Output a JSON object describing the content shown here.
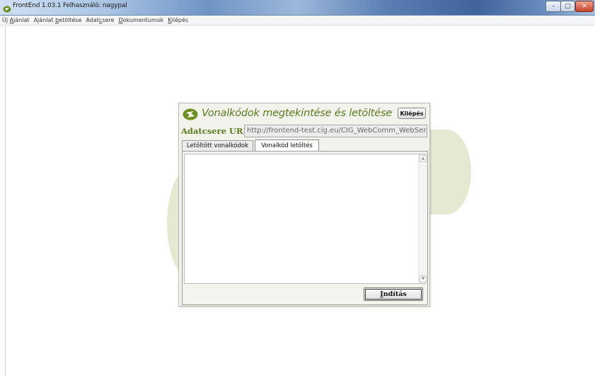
{
  "window": {
    "title": "FrontEnd 1.03.1  Felhasználó: nagypal",
    "controls": {
      "minimize": "–",
      "maximize": "▢",
      "close": "✕"
    }
  },
  "menu": {
    "items": [
      {
        "prefix": "Új ",
        "accel": "A",
        "suffix": "jánlat"
      },
      {
        "prefix": "Ajánlat ",
        "accel": "b",
        "suffix": "etöltése"
      },
      {
        "prefix": "Adat",
        "accel": "c",
        "suffix": "sere"
      },
      {
        "prefix": "",
        "accel": "D",
        "suffix": "okumentumok"
      },
      {
        "prefix": "",
        "accel": "K",
        "suffix": "ilépés"
      }
    ]
  },
  "dialog": {
    "title": "Vonalkódok megtekintése és letöltése",
    "exit_button": "Kilépés",
    "url_label": "Adatcsere URL:",
    "url_value": "http://frontend-test.cig.eu/CIG_WebComm_WebSer...",
    "tabs": [
      {
        "label": "Letöltött vonalkódok",
        "active": false
      },
      {
        "label": "Vonalkód letöltés",
        "active": true
      }
    ],
    "textarea_value": "",
    "start_button": {
      "accel": "I",
      "rest": "ndítás"
    }
  },
  "colors": {
    "accent_green": "#5b7a1e",
    "deco_shape": "#e7e8d2",
    "dialog_bg": "#f3f3ee"
  },
  "icons": {
    "app": "frontend-logo-icon",
    "dialog": "frontend-logo-icon"
  }
}
